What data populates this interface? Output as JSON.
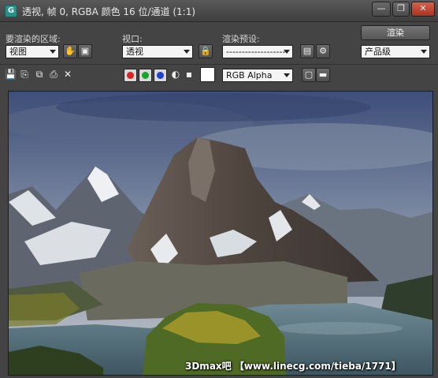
{
  "window": {
    "title": "透视, 帧 0, RGBA 颜色 16 位/通道 (1:1)",
    "app_icon_letter": "G",
    "min_glyph": "—",
    "max_glyph": "❐",
    "close_glyph": "✕"
  },
  "controls": {
    "area_label": "要渲染的区域:",
    "area_value": "视图",
    "viewport_label": "视口:",
    "viewport_value": "透视",
    "preset_label": "渲染预设:",
    "preset_value": "--------------------",
    "render_button": "渲染",
    "quality_value": "产品级"
  },
  "toolbar": {
    "channel_value": "RGB Alpha",
    "icons": [
      "save-icon",
      "copy-icon",
      "clone-icon",
      "print-icon",
      "clear-icon",
      "mono-icon",
      "background-icon"
    ],
    "colors": {
      "red": "#e02020",
      "green": "#1aa32a",
      "blue": "#1f3fd8"
    }
  },
  "viewport": {
    "watermark": "3Dmax吧 【www.linecg.com/tieba/1771】"
  }
}
